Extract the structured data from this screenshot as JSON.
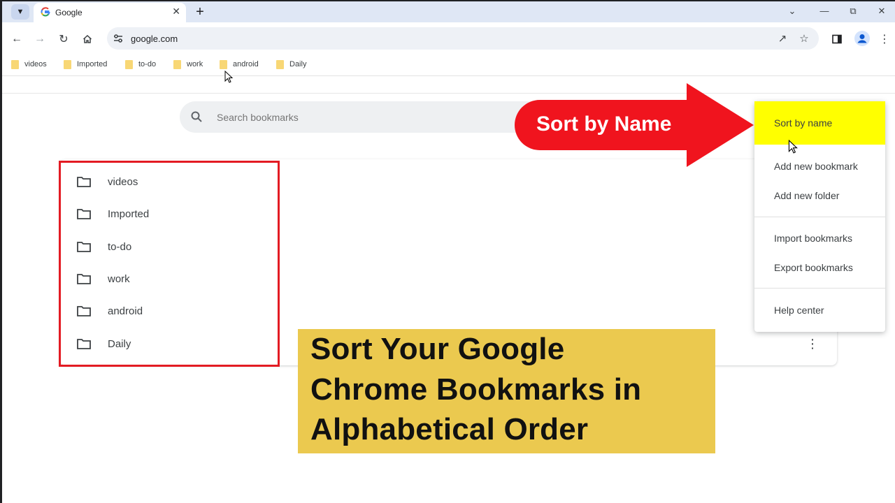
{
  "browser": {
    "tab": {
      "title": "Google"
    },
    "address": {
      "url": "google.com"
    }
  },
  "bookmarks_bar": {
    "items": [
      {
        "label": "videos"
      },
      {
        "label": "Imported"
      },
      {
        "label": "to-do"
      },
      {
        "label": "work"
      },
      {
        "label": "android"
      },
      {
        "label": "Daily"
      }
    ]
  },
  "bookmark_manager": {
    "search_placeholder": "Search bookmarks",
    "folders": [
      {
        "label": "videos"
      },
      {
        "label": "Imported"
      },
      {
        "label": "to-do"
      },
      {
        "label": "work"
      },
      {
        "label": "android"
      },
      {
        "label": "Daily"
      }
    ]
  },
  "menu": {
    "items": [
      {
        "label": "Sort by name",
        "highlighted": true
      },
      {
        "label": "Add new bookmark"
      },
      {
        "label": "Add new folder"
      },
      {
        "label": "Import bookmarks"
      },
      {
        "label": "Export bookmarks"
      },
      {
        "label": "Help center"
      }
    ]
  },
  "annotation": {
    "arrow_label": "Sort by Name",
    "arrow_color": "#f0141e",
    "highlight_color": "#ffff00"
  },
  "banner": {
    "lines": [
      "Sort Your Google",
      "Chrome Bookmarks in",
      "Alphabetical Order"
    ],
    "background": "#ebc94f"
  }
}
